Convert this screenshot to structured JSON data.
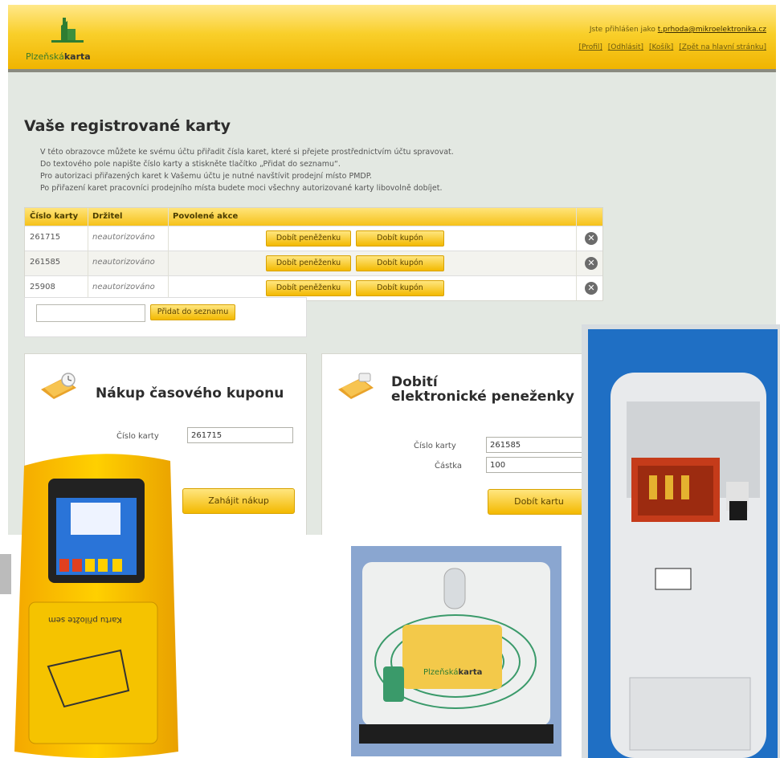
{
  "header": {
    "logo_text_a": "Plzeňská",
    "logo_text_b": "karta",
    "logged_in_prefix": "Jste přihlášen jako",
    "user_email": "t.prhoda@mikroelektronika.cz",
    "nav_links": [
      "[Profil]",
      "[Odhlásit]",
      "[Košík]",
      "[Zpět na hlavní stránku]"
    ]
  },
  "page": {
    "title": "Vaše registrované karty",
    "intro_lines": [
      "V této obrazovce můžete ke svému účtu přiřadit čísla karet, které si přejete prostřednictvím účtu spravovat.",
      "Do textového pole napište číslo karty a stiskněte tlačítko „Přidat do seznamu“.",
      "Pro autorizaci přiřazených karet k Vašemu účtu je nutné navštívit prodejní místo PMDP.",
      "Po přiřazení karet pracovníci prodejního místa budete moci všechny autorizované karty libovolně dobíjet."
    ]
  },
  "table": {
    "headers": [
      "Číslo karty",
      "Držitel",
      "Povolené akce"
    ],
    "rows": [
      {
        "card": "261715",
        "holder": "neautorizováno"
      },
      {
        "card": "261585",
        "holder": "neautorizováno"
      },
      {
        "card": "25908",
        "holder": "neautorizováno"
      }
    ],
    "btn_wallet": "Dobít peněženku",
    "btn_coupon": "Dobít kupón",
    "delete_glyph": "✕"
  },
  "add": {
    "input_value": "",
    "button_label": "Přidat do seznamu"
  },
  "coupon_panel": {
    "title": "Nákup časového kuponu",
    "card_label": "Číslo karty",
    "card_value": "261715",
    "button_label": "Zahájit nákup"
  },
  "wallet_panel": {
    "title_line1": "Dobití",
    "title_line2": "elektronické peneženky",
    "card_label": "Číslo karty",
    "card_value": "261585",
    "amount_label": "Částka",
    "amount_value": "100",
    "button_label": "Dobít kartu"
  },
  "reader_device": {
    "slot_text": "Kartu přiložte sem"
  },
  "card_on_reader": {
    "text_a": "Plzeňská",
    "text_b": "karta"
  },
  "colors": {
    "accent_yellow": "#f6c21a",
    "header_border": "#8a8a80",
    "page_bg": "#e3e8e2",
    "kiosk_blue": "#1f6fc4",
    "reader_yellow": "#f5b800"
  }
}
